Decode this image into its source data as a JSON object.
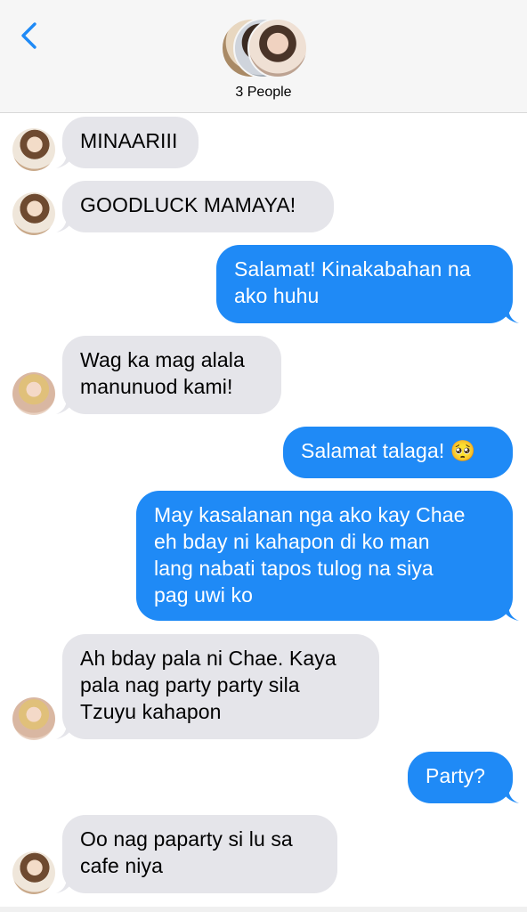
{
  "header": {
    "group_title": "3 People",
    "back_icon": "chevron-left-icon",
    "accent_color": "#1f8af6"
  },
  "messages": [
    {
      "direction": "incoming",
      "text": "MINAARIII"
    },
    {
      "direction": "incoming",
      "text": "GOODLUCK MAMAYA!"
    },
    {
      "direction": "outgoing",
      "text": "Salamat! Kinakabahan na\nako huhu"
    },
    {
      "direction": "incoming",
      "text": "Wag ka mag alala\nmanunuod kami!"
    },
    {
      "direction": "outgoing",
      "text": "Salamat talaga! 🥺"
    },
    {
      "direction": "outgoing",
      "text": "May kasalanan nga ako kay Chae\neh bday ni kahapon di ko man\nlang nabati tapos tulog na siya\npag uwi ko"
    },
    {
      "direction": "incoming",
      "text": "Ah bday pala ni Chae. Kaya\npala nag party party sila\nTzuyu kahapon"
    },
    {
      "direction": "outgoing",
      "text": "Party?"
    },
    {
      "direction": "incoming",
      "text": "Oo nag paparty si lu sa\ncafe niya"
    }
  ],
  "colors": {
    "incoming_bubble": "#e5e5ea",
    "outgoing_bubble": "#1f8af6"
  }
}
